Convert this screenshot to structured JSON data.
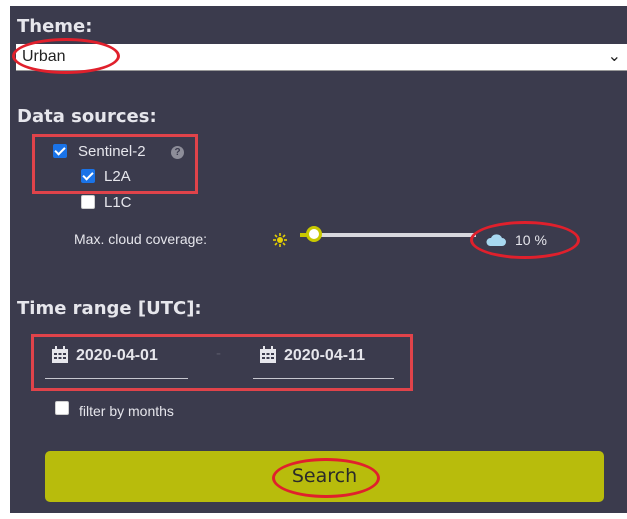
{
  "theme": {
    "heading": "Theme:",
    "selected": "Urban"
  },
  "data_sources": {
    "heading": "Data sources:",
    "sentinel2": {
      "label": "Sentinel-2",
      "checked": true,
      "help_glyph": "?"
    },
    "l2a": {
      "label": "L2A",
      "checked": true
    },
    "l1c": {
      "label": "L1C",
      "checked": false
    },
    "cloud": {
      "label": "Max. cloud coverage:",
      "value_text": "10 %",
      "value": 10
    }
  },
  "time_range": {
    "heading": "Time range [UTC]:",
    "from": "2020-04-01",
    "separator": "-",
    "to": "2020-04-11",
    "filter_months": {
      "label": "filter by months",
      "checked": false
    }
  },
  "search": {
    "label": "Search"
  },
  "icons": {
    "calendar": "calendar-icon",
    "sun": "sun-icon",
    "cloud": "cloud-icon",
    "chevron": "chevron-down-icon",
    "help": "help-icon"
  },
  "colors": {
    "panel": "#3b3b4d",
    "accent": "#b8bc0c",
    "checkbox": "#1a73e8",
    "annotation": "#e0434a"
  }
}
